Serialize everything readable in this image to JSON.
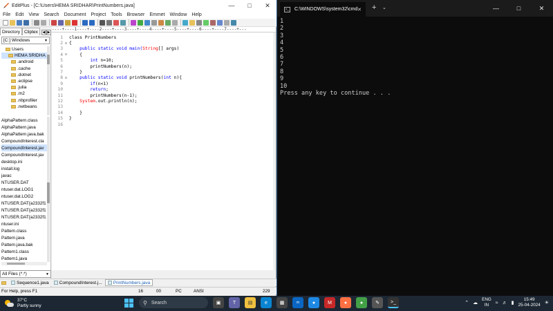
{
  "editplus": {
    "title": "EditPlus - [C:\\Users\\HEMA SRIDHAR\\PrintNumbers.java]",
    "menu": [
      "File",
      "Edit",
      "View",
      "Search",
      "Document",
      "Project",
      "Tools",
      "Browser",
      "Emmet",
      "Window",
      "Help"
    ],
    "sidebar": {
      "tab_directory": "Directory",
      "tab_cliptext": "Cliptex",
      "drive": "[C:] Windows",
      "tree": [
        "Users",
        "HEMA SRIDHA",
        ".android",
        ".cache",
        ".dotnet",
        ".eclipse",
        ".julia",
        ".m2",
        ".nbprofiler",
        ".netbeans"
      ],
      "files": [
        "AlphaPattern.class",
        "AlphaPattern.java",
        "AlphaPattern.java.bak",
        "CompoundInterest.cla",
        "CompoundInterest.jav",
        "CompoundInterest.jav",
        "desktop.ini",
        "install.log",
        "javac",
        "NTUSER.DAT",
        "ntuser.dat.LOG1",
        "ntuser.dat.LOG2",
        "NTUSER.DAT{a2332f1",
        "NTUSER.DAT{a2332f1",
        "NTUSER.DAT{a2332f1",
        "ntuser.ini",
        "Pattern.class",
        "Pattern.java",
        "Pattern.java.bak",
        "Pattern1.class",
        "Pattern1.java"
      ],
      "filter": "All Files (*.*)"
    },
    "ruler": "----+----1----+----2----+----3----+----4----+----5----+----6----+----7----+---",
    "code": {
      "l1": "class PrintNumbers",
      "l2": "{",
      "l3a": "    public static void main(",
      "l3b": "String",
      "l3c": "[] args)",
      "l4": "    {",
      "l5a": "        int",
      "l5b": " n=10;",
      "l6": "        printNumbers(n);",
      "l7": "    }",
      "l8a": "    public static void",
      "l8b": " printNumbers(",
      "l8c": "int",
      "l8d": " n){",
      "l9a": "        if",
      "l9b": "(n<1)",
      "l10a": "        return",
      "l10b": ";",
      "l11": "        printNumbers(n-1);",
      "l12a": "    System",
      "l12b": ".out.println(n);",
      "l13": "",
      "l14": "    }",
      "l15": "}",
      "l16": ""
    },
    "tabs": [
      "Sequence1.java",
      "CompoundInterest.j...",
      "PrintNumbers.java"
    ],
    "status": {
      "help": "For Help, press F1",
      "ln": "16",
      "col": "00",
      "mode": "PC",
      "enc": "ANSI",
      "size": "229"
    }
  },
  "console": {
    "tab_title": "C:\\WINDOWS\\system32\\cmd.",
    "output": [
      "1",
      "2",
      "3",
      "4",
      "5",
      "6",
      "7",
      "8",
      "9",
      "10",
      "Press any key to continue . . ."
    ]
  },
  "taskbar": {
    "weather_temp": "37°C",
    "weather_desc": "Partly sunny",
    "search_placeholder": "Search",
    "lang_top": "ENG",
    "lang_bottom": "IN",
    "time": "15:49",
    "date": "25-04-2024"
  }
}
